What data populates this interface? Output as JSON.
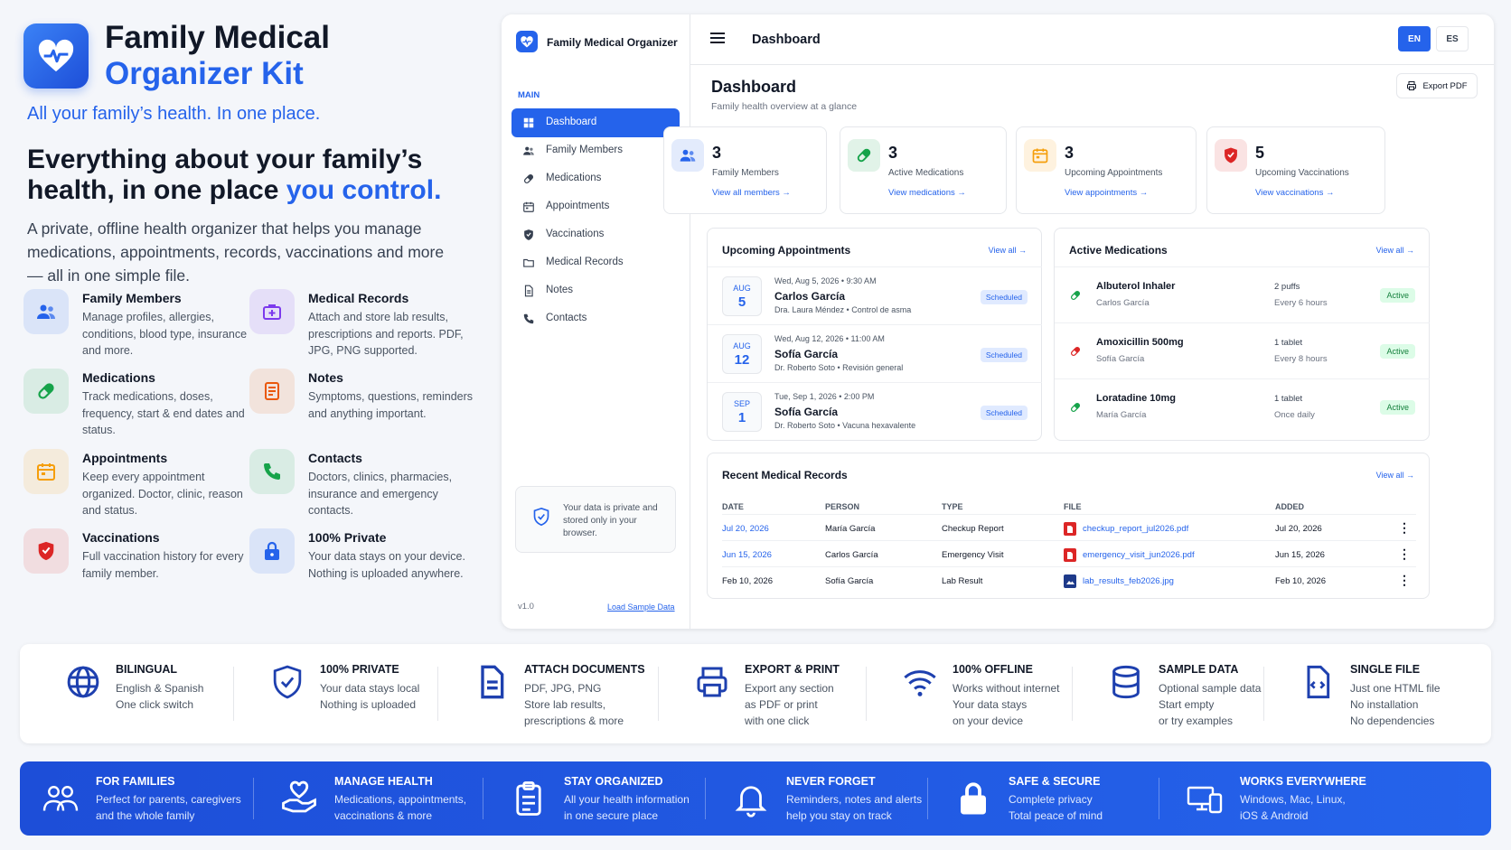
{
  "brand": {
    "line1": "Family Medical",
    "line2": "Organizer Kit",
    "tagline": "All your family’s health. In one place."
  },
  "headline": {
    "part1": "Everything about your family’s health, in one place ",
    "highlight": "you control."
  },
  "intro": "A private, offline health organizer that helps you manage medications, appointments, records, vaccinations and more — all in one simple file.",
  "features": [
    {
      "title": "Family Members",
      "desc": "Manage profiles, allergies, conditions, blood type, insurance and more.",
      "icon": "users-icon",
      "color": "#2563eb"
    },
    {
      "title": "Medical Records",
      "desc": "Attach and store lab results, prescriptions and reports. PDF, JPG, PNG supported.",
      "icon": "medical-case-icon",
      "color": "#7c3aed"
    },
    {
      "title": "Medications",
      "desc": "Track medications, doses, frequency, start & end dates and status.",
      "icon": "pill-icon",
      "color": "#16a34a"
    },
    {
      "title": "Notes",
      "desc": "Symptoms, questions, reminders and anything important.",
      "icon": "notes-icon",
      "color": "#ea580c"
    },
    {
      "title": "Appointments",
      "desc": "Keep every appointment organized. Doctor, clinic, reason and status.",
      "icon": "calendar-icon",
      "color": "#f59e0b"
    },
    {
      "title": "Contacts",
      "desc": "Doctors, clinics, pharmacies, insurance and emergency contacts.",
      "icon": "phone-icon",
      "color": "#16a34a"
    },
    {
      "title": "Vaccinations",
      "desc": "Full vaccination history for every family member.",
      "icon": "shield-icon",
      "color": "#dc2626"
    },
    {
      "title": "100% Private",
      "desc": "Your data stays on your device. Nothing is uploaded anywhere.",
      "icon": "lock-icon",
      "color": "#2563eb"
    }
  ],
  "app": {
    "sidebar": {
      "title": "Family Medical Organizer",
      "section": "MAIN",
      "items": [
        {
          "label": "Dashboard",
          "icon": "grid-icon"
        },
        {
          "label": "Family Members",
          "icon": "users-icon"
        },
        {
          "label": "Medications",
          "icon": "pill-icon"
        },
        {
          "label": "Appointments",
          "icon": "calendar-icon"
        },
        {
          "label": "Vaccinations",
          "icon": "shield-icon"
        },
        {
          "label": "Medical Records",
          "icon": "folder-icon"
        },
        {
          "label": "Notes",
          "icon": "document-icon"
        },
        {
          "label": "Contacts",
          "icon": "phone-icon"
        }
      ],
      "privacy": "Your data is private and stored only in your browser.",
      "version": "v1.0",
      "load_sample": "Load Sample Data"
    },
    "topbar": {
      "title": "Dashboard",
      "lang_en": "EN",
      "lang_es": "ES"
    },
    "header": {
      "title": "Dashboard",
      "subtitle": "Family health overview at a glance",
      "export": "Export PDF"
    },
    "stats": [
      {
        "value": "3",
        "label": "Family Members",
        "link": "View all members →",
        "icon": "users-icon",
        "color": "#2563eb"
      },
      {
        "value": "3",
        "label": "Active Medications",
        "link": "View medications →",
        "icon": "pill-icon",
        "color": "#16a34a"
      },
      {
        "value": "3",
        "label": "Upcoming Appointments",
        "link": "View appointments →",
        "icon": "calendar-icon",
        "color": "#f59e0b"
      },
      {
        "value": "5",
        "label": "Upcoming Vaccinations",
        "link": "View vaccinations →",
        "icon": "shield-icon",
        "color": "#dc2626"
      }
    ],
    "appointments": {
      "title": "Upcoming Appointments",
      "view_all": "View all →",
      "items": [
        {
          "month": "AUG",
          "day": "5",
          "when": "Wed, Aug 5, 2026 • 9:30 AM",
          "name": "Carlos García",
          "detail": "Dra. Laura Méndez • Control de asma",
          "status": "Scheduled"
        },
        {
          "month": "AUG",
          "day": "12",
          "when": "Wed, Aug 12, 2026 • 11:00 AM",
          "name": "Sofía García",
          "detail": "Dr. Roberto Soto • Revisión general",
          "status": "Scheduled"
        },
        {
          "month": "SEP",
          "day": "1",
          "when": "Tue, Sep 1, 2026 • 2:00 PM",
          "name": "Sofía García",
          "detail": "Dr. Roberto Soto • Vacuna hexavalente",
          "status": "Scheduled"
        }
      ]
    },
    "medications": {
      "title": "Active Medications",
      "view_all": "View all →",
      "items": [
        {
          "name": "Albuterol Inhaler",
          "person": "Carlos García",
          "dose": "2 puffs",
          "freq": "Every 6 hours",
          "status": "Active",
          "color": "#16a34a"
        },
        {
          "name": "Amoxicillin 500mg",
          "person": "Sofía García",
          "dose": "1 tablet",
          "freq": "Every 8 hours",
          "status": "Active",
          "color": "#dc2626"
        },
        {
          "name": "Loratadine 10mg",
          "person": "María García",
          "dose": "1 tablet",
          "freq": "Once daily",
          "status": "Active",
          "color": "#16a34a"
        }
      ]
    },
    "records": {
      "title": "Recent Medical Records",
      "view_all": "View all →",
      "columns": [
        "DATE",
        "PERSON",
        "TYPE",
        "FILE",
        "ADDED"
      ],
      "rows": [
        {
          "date": "Jul 20, 2026",
          "person": "María García",
          "type": "Checkup Report",
          "file": "checkup_report_jul2026.pdf",
          "added": "Jul 20, 2026",
          "file_icon": "pdf-icon",
          "icon_color": "#dc2626",
          "date_color": "#2563eb"
        },
        {
          "date": "Jun 15, 2026",
          "person": "Carlos García",
          "type": "Emergency Visit",
          "file": "emergency_visit_jun2026.pdf",
          "added": "Jun 15, 2026",
          "file_icon": "pdf-icon",
          "icon_color": "#dc2626",
          "date_color": "#2563eb"
        },
        {
          "date": "Feb 10, 2026",
          "person": "Sofía García",
          "type": "Lab Result",
          "file": "lab_results_feb2026.jpg",
          "added": "Feb 10, 2026",
          "file_icon": "image-icon",
          "icon_color": "#1e3a8a",
          "date_color": "#111827"
        }
      ]
    }
  },
  "strip": [
    {
      "title": "BILINGUAL",
      "desc": "English & Spanish\nOne click switch",
      "icon": "globe-icon"
    },
    {
      "title": "100% PRIVATE",
      "desc": "Your data stays local\nNothing is uploaded",
      "icon": "shield-check-icon"
    },
    {
      "title": "ATTACH DOCUMENTS",
      "desc": "PDF, JPG, PNG\nStore lab results,\nprescriptions & more",
      "icon": "document-icon"
    },
    {
      "title": "EXPORT & PRINT",
      "desc": "Export any section\nas PDF or print\nwith one click",
      "icon": "printer-icon"
    },
    {
      "title": "100% OFFLINE",
      "desc": "Works without internet\nYour data stays\non your device",
      "icon": "wifi-icon"
    },
    {
      "title": "SAMPLE DATA",
      "desc": "Optional sample data\nStart empty\nor try examples",
      "icon": "database-icon"
    },
    {
      "title": "SINGLE FILE",
      "desc": "Just one HTML file\nNo installation\nNo dependencies",
      "icon": "code-file-icon"
    }
  ],
  "band": [
    {
      "title": "FOR FAMILIES",
      "desc": "Perfect for parents, caregivers\nand the whole family",
      "icon": "family-icon"
    },
    {
      "title": "MANAGE HEALTH",
      "desc": "Medications, appointments,\nvaccinations & more",
      "icon": "heart-hand-icon"
    },
    {
      "title": "STAY ORGANIZED",
      "desc": "All your health information\nin one secure place",
      "icon": "clipboard-icon"
    },
    {
      "title": "NEVER FORGET",
      "desc": "Reminders, notes and alerts\nhelp you stay on track",
      "icon": "bell-icon"
    },
    {
      "title": "SAFE & SECURE",
      "desc": "Complete privacy\nTotal peace of mind",
      "icon": "lock-icon"
    },
    {
      "title": "WORKS EVERYWHERE",
      "desc": "Windows, Mac, Linux,\niOS & Android",
      "icon": "devices-icon"
    }
  ]
}
